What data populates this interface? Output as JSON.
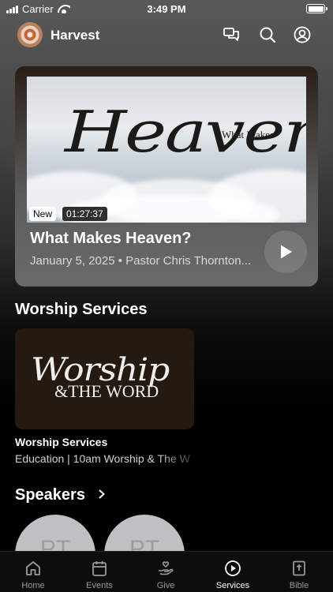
{
  "status_bar": {
    "carrier": "Carrier",
    "time": "3:49 PM"
  },
  "header": {
    "app_name": "Harvest"
  },
  "featured": {
    "image_title_main": "Heaven",
    "image_title_small": "What Makes",
    "badge_new": "New",
    "duration": "01:27:37",
    "title": "What Makes Heaven?",
    "meta": "January 5, 2025 • Pastor Chris Thornton..."
  },
  "worship_section": {
    "heading": "Worship Services",
    "card": {
      "image_script": "Worship",
      "image_word": "&THE WORD",
      "title": "Worship Services",
      "subtitle": "Education | 10am  Worship & The W"
    }
  },
  "speakers_section": {
    "heading": "Speakers",
    "speakers": [
      {
        "initials": "PT"
      },
      {
        "initials": "PT"
      }
    ]
  },
  "tabs": [
    {
      "label": "Home",
      "icon": "home-icon",
      "active": false
    },
    {
      "label": "Events",
      "icon": "calendar-icon",
      "active": false
    },
    {
      "label": "Give",
      "icon": "give-icon",
      "active": false
    },
    {
      "label": "Services",
      "icon": "play-circle-icon",
      "active": true
    },
    {
      "label": "Bible",
      "icon": "bible-icon",
      "active": false
    }
  ],
  "colors": {
    "background": "#000000",
    "tab_active": "#ffffff",
    "tab_inactive": "#9a9a9a"
  }
}
